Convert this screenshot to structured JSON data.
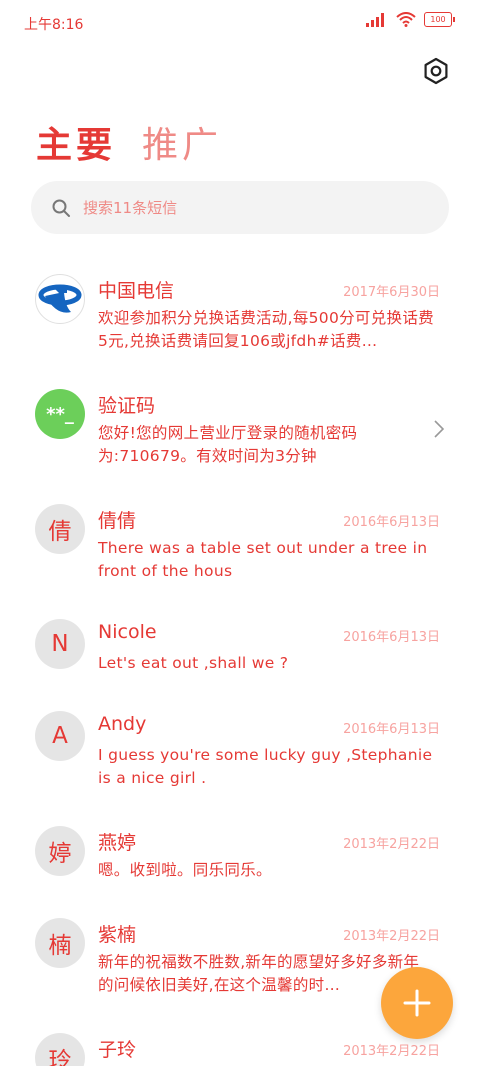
{
  "status_bar": {
    "time": "上午8:16",
    "battery": "100"
  },
  "tabs": [
    {
      "label": "主要"
    },
    {
      "label": "推广"
    }
  ],
  "search": {
    "placeholder": "搜索11条短信"
  },
  "conversations": [
    {
      "avatar": "",
      "avatar_icon": "china-telecom-logo",
      "name": "中国电信",
      "date": "2017年6月30日",
      "message": "欢迎参加积分兑换话费活动,每500分可兑换话费5元,兑换话费请回复106或jfdh#话费…"
    },
    {
      "avatar": "**_",
      "name": "验证码",
      "date": "",
      "message": "您好!您的网上营业厅登录的随机密码为:710679。有效时间为3分钟"
    },
    {
      "avatar": "倩",
      "name": "倩倩",
      "date": "2016年6月13日",
      "message": "There was a table set out under a tree in front of the hous"
    },
    {
      "avatar": "N",
      "name": "Nicole",
      "date": "2016年6月13日",
      "message": "Let's eat out ,shall we ?"
    },
    {
      "avatar": "A",
      "name": "Andy",
      "date": "2016年6月13日",
      "message": "I guess you're some lucky guy ,Stephanie is a nice girl ."
    },
    {
      "avatar": "婷",
      "name": "燕婷",
      "date": "2013年2月22日",
      "message": "嗯。收到啦。同乐同乐。"
    },
    {
      "avatar": "楠",
      "name": "紫楠",
      "date": "2013年2月22日",
      "message": "新年的祝福数不胜数,新年的愿望好多好多新年的问候依旧美好,在这个温馨的时…"
    },
    {
      "avatar": "玲",
      "name": "子玲",
      "date": "2013年2月22日",
      "message": ""
    }
  ],
  "colors": {
    "accent": "#e53935",
    "fab": "#fca63c",
    "verify_avatar": "#6ccf5a"
  },
  "icons": {
    "settings": "gear-icon",
    "search": "search-icon",
    "fab": "plus-icon",
    "chevron": "chevron-right-icon"
  }
}
